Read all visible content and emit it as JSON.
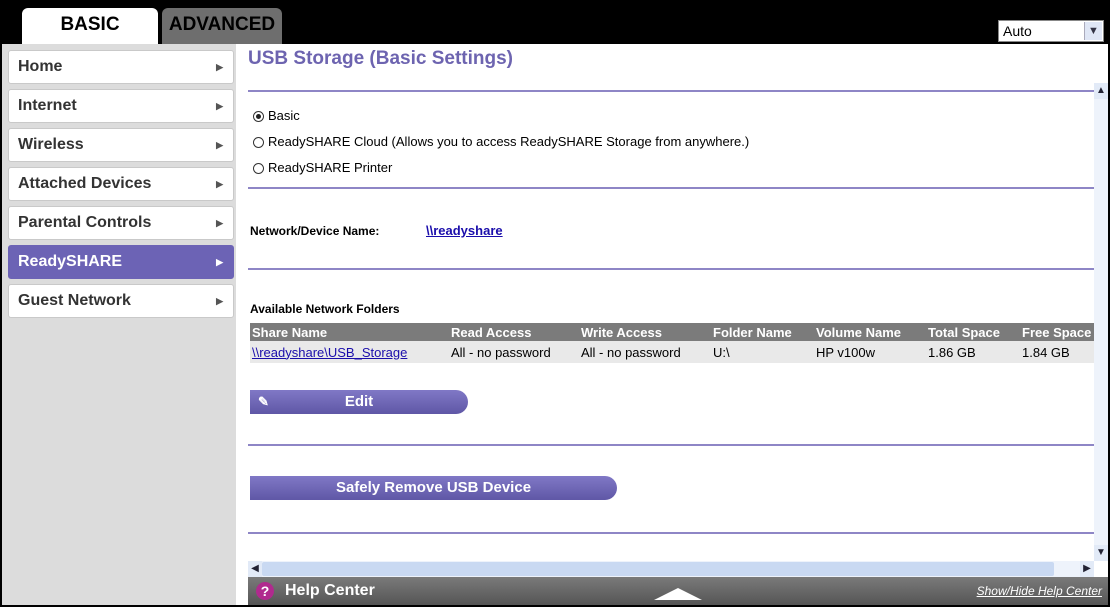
{
  "tabs": {
    "basic": "BASIC",
    "advanced": "ADVANCED"
  },
  "language": {
    "selected": "Auto"
  },
  "sidebar": {
    "items": [
      {
        "label": "Home"
      },
      {
        "label": "Internet"
      },
      {
        "label": "Wireless"
      },
      {
        "label": "Attached Devices"
      },
      {
        "label": "Parental Controls"
      },
      {
        "label": "ReadySHARE",
        "active": true
      },
      {
        "label": "Guest Network"
      }
    ]
  },
  "main": {
    "title": "USB Storage (Basic Settings)",
    "options": [
      {
        "label": "Basic",
        "selected": true
      },
      {
        "label": "ReadySHARE Cloud (Allows you to access ReadySHARE Storage from anywhere.)",
        "selected": false
      },
      {
        "label": "ReadySHARE Printer",
        "selected": false
      }
    ],
    "device_name_label": "Network/Device Name:",
    "device_name_value": "\\\\readyshare",
    "folders_title": "Available Network Folders",
    "table": {
      "headers": [
        "Share Name",
        "Read Access",
        "Write Access",
        "Folder Name",
        "Volume Name",
        "Total Space",
        "Free Space"
      ],
      "rows": [
        [
          "\\\\readyshare\\USB_Storage",
          "All - no password",
          "All - no password",
          "U:\\",
          "HP v100w",
          "1.86 GB",
          "1.84 GB"
        ]
      ]
    },
    "edit_label": "Edit",
    "remove_label": "Safely Remove USB Device"
  },
  "help": {
    "label": "Help Center",
    "toggle": "Show/Hide Help Center"
  },
  "colors": {
    "accent": "#6c63b5",
    "title": "#6d64b0",
    "table_header": "#7b7b7b"
  }
}
